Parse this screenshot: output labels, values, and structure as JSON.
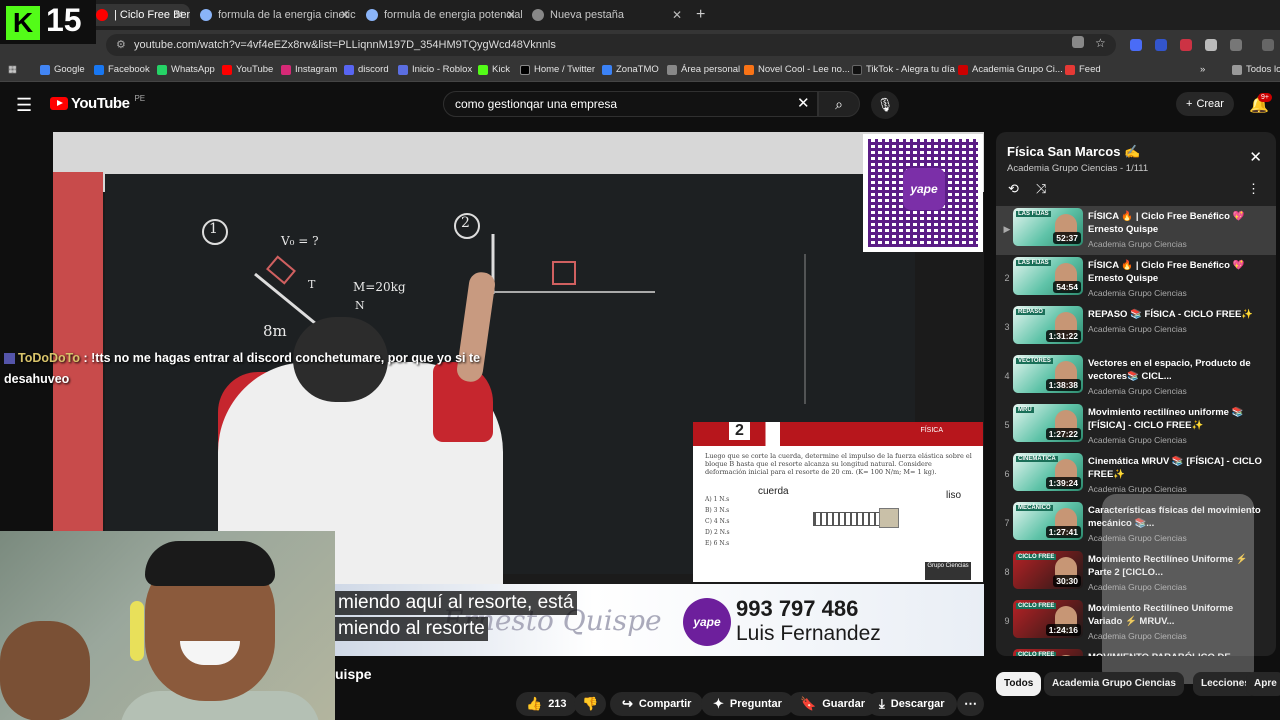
{
  "browser": {
    "tabs": [
      {
        "label": "| Ciclo Free Benéfi",
        "active": true
      },
      {
        "label": "formula de la energia cinetica",
        "active": false
      },
      {
        "label": "formula de energia potencial -",
        "active": false
      },
      {
        "label": "Nueva pestaña",
        "active": false
      }
    ],
    "url": "youtube.com/watch?v=4vf4eEZx8rw&list=PLLiqnnM197D_354HM9TQygWcd48Vknnls",
    "bookmarks": [
      {
        "label": "Google",
        "color": "#4285f4"
      },
      {
        "label": "Facebook",
        "color": "#1877f2"
      },
      {
        "label": "WhatsApp",
        "color": "#25d366"
      },
      {
        "label": "YouTube",
        "color": "#ff0000"
      },
      {
        "label": "Instagram",
        "color": "#d62976"
      },
      {
        "label": "discord",
        "color": "#5865f2"
      },
      {
        "label": "Inicio - Roblox",
        "color": "#5b6ee1"
      },
      {
        "label": "Kick",
        "color": "#53fc18"
      },
      {
        "label": "Home / Twitter",
        "color": "#000000"
      },
      {
        "label": "ZonaTMO",
        "color": "#3b82f6"
      },
      {
        "label": "Área personal",
        "color": "#888888"
      },
      {
        "label": "Novel Cool - Lee no...",
        "color": "#f97316"
      },
      {
        "label": "TikTok - Alegra tu día",
        "color": "#111111"
      },
      {
        "label": "Academia Grupo Ci...",
        "color": "#cc0000"
      },
      {
        "label": "Feed",
        "color": "#e53935"
      },
      {
        "label": "Todos lo",
        "color": "#999999"
      }
    ]
  },
  "kick_overlay": {
    "logo": "K",
    "count": "15"
  },
  "youtube": {
    "logo_text": "YouTube",
    "country": "PE",
    "search_value": "como gestionqar una empresa",
    "create_label": "Crear",
    "notifications": "9+"
  },
  "video": {
    "title_fragment": "uispe",
    "subtitle_lines": [
      "miendo aquí al resorte, está",
      "miendo al resorte"
    ],
    "promo_phone": "993 797 486",
    "promo_name": "Luis Fernandez",
    "promo_signature": "Ernesto Quispe",
    "yape_label": "yape",
    "problem": {
      "number": "2",
      "tag": "FÍSICA",
      "text": "Luego que se corte la cuerda, determine el impulso de la fuerza elástica sobre el bloque B hasta que el resorte alcanza su longitud natural. Considere deformación inicial para el resorte de 20 cm.",
      "constants": "(K= 100 N/m; M= 1 kg).",
      "options": [
        "A) 1 N.s",
        "B) 3 N.s",
        "C) 4 N.s",
        "D) 2 N.s",
        "E) 6 N.s"
      ],
      "cuerda_label": "cuerda",
      "liso_label": "liso",
      "logo": "Grupo Ciencias"
    },
    "chalk": {
      "n1": "1",
      "n2": "2",
      "v0": "V₀ = ?",
      "mass": "M=20kg",
      "eight": "8m",
      "t": "T",
      "n": "N"
    }
  },
  "chat": {
    "user": "ToDoDoTo",
    "message": ": !tts no me hagas entrar al discord conchetumare, por que yo si te desahuveo"
  },
  "actions": {
    "likes": "213",
    "share": "Compartir",
    "ask": "Preguntar",
    "save": "Guardar",
    "download": "Descargar"
  },
  "playlist": {
    "title": "Física San Marcos ✍",
    "channel_progress": "Academia Grupo Ciencias - 1/111",
    "items": [
      {
        "index": "▶",
        "title": "FÍSICA 🔥 | Ciclo Free Benéfico 💖 Ernesto Quispe",
        "channel": "Academia Grupo Ciencias",
        "duration": "52:37",
        "tag": "LAS FIJAS",
        "dark": false
      },
      {
        "index": "2",
        "title": "FÍSICA 🔥 | Ciclo Free Benéfico 💖 Ernesto Quispe",
        "channel": "Academia Grupo Ciencias",
        "duration": "54:54",
        "tag": "LAS FIJAS",
        "dark": false
      },
      {
        "index": "3",
        "title": "REPASO 📚 FÍSICA - CICLO FREE✨",
        "channel": "Academia Grupo Ciencias",
        "duration": "1:31:22",
        "tag": "REPASO",
        "dark": false
      },
      {
        "index": "4",
        "title": "Vectores en el espacio, Producto de vectores📚 CICL...",
        "channel": "Academia Grupo Ciencias",
        "duration": "1:38:38",
        "tag": "VECTORES",
        "dark": false
      },
      {
        "index": "5",
        "title": "Movimiento rectilíneo uniforme 📚 [FÍSICA] - CICLO FREE✨",
        "channel": "Academia Grupo Ciencias",
        "duration": "1:27:22",
        "tag": "MRU",
        "dark": false
      },
      {
        "index": "6",
        "title": "Cinemática MRUV 📚 [FÍSICA] - CICLO FREE✨",
        "channel": "Academia Grupo Ciencias",
        "duration": "1:39:24",
        "tag": "CINEMÁTICA",
        "dark": false
      },
      {
        "index": "7",
        "title": "Características físicas del movimiento mecánico 📚...",
        "channel": "Academia Grupo Ciencias",
        "duration": "1:27:41",
        "tag": "MECÁNICO",
        "dark": false
      },
      {
        "index": "8",
        "title": "Movimiento Rectilíneo Uniforme ⚡ Parte 2 [CICLO...",
        "channel": "Academia Grupo Ciencias",
        "duration": "30:30",
        "tag": "CICLO FREE",
        "dark": true
      },
      {
        "index": "9",
        "title": "Movimiento Rectilíneo Uniforme Variado ⚡ MRUV...",
        "channel": "Academia Grupo Ciencias",
        "duration": "1:24:16",
        "tag": "CICLO FREE",
        "dark": true
      },
      {
        "index": "10",
        "title": "MOVIMIENTO PARABÓLICO DE",
        "channel": "",
        "duration": "",
        "tag": "CICLO FREE",
        "dark": true
      }
    ]
  },
  "chips": [
    "Todos",
    "Academia Grupo Ciencias",
    "Lecciones",
    "Apre"
  ]
}
